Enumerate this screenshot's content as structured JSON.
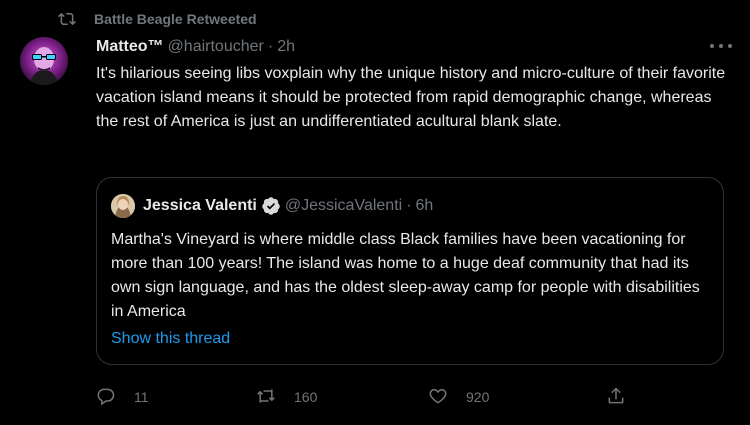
{
  "social_context": {
    "text": "Battle Beagle Retweeted",
    "icon": "retweet-icon"
  },
  "tweet": {
    "author_name": "Matteo™",
    "handle": "@hairtoucher",
    "separator": "·",
    "time": "2h",
    "text": "It's hilarious seeing libs voxplain why the unique history and micro-culture of their favorite vacation island means it should be protected from rapid demographic change, whereas the rest of America is just an undifferentiated acultural blank slate.",
    "more_icon": "more-horizontal-icon"
  },
  "quote": {
    "author_name": "Jessica Valenti",
    "verified_icon": "verified-badge-icon",
    "handle": "@JessicaValenti",
    "separator": "·",
    "time": "6h",
    "text": "Martha's Vineyard is where middle class Black families have been vacationing for more than 100 years! The island was home to a huge deaf community that had its own sign language, and has the oldest sleep-away camp for people with disabilities in America",
    "show_thread": "Show this thread"
  },
  "actions": {
    "reply": {
      "icon": "reply-icon",
      "count": "11"
    },
    "retweet": {
      "icon": "retweet-icon",
      "count": "160"
    },
    "like": {
      "icon": "heart-icon",
      "count": "920"
    },
    "share": {
      "icon": "share-icon"
    }
  },
  "colors": {
    "background": "#000000",
    "text": "#e7e9ea",
    "muted": "#71767b",
    "link": "#1d9bf0",
    "border": "#2f3336",
    "verified": "#d9d9d9"
  }
}
